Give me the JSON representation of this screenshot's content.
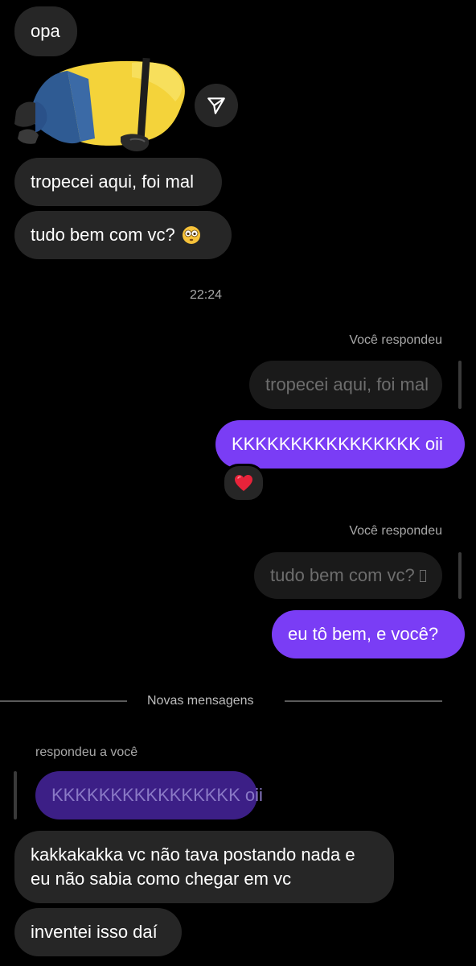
{
  "messages": {
    "m1": "opa",
    "m2": "tropecei aqui, foi mal",
    "m3": "tudo bem com vc?",
    "m4": "KKKKKKKKKKKKKKKK oii",
    "m5": "eu tô bem, e você?",
    "m6_line1": "kakkakakka vc não tava postando nada e",
    "m6_line2": "eu não sabia como chegar em vc",
    "m7": "inventei isso daí"
  },
  "timestamp": "22:24",
  "replies": {
    "r1_label": "Você respondeu",
    "r1_quote": "tropecei aqui, foi mal",
    "r2_label": "Você respondeu",
    "r2_quote": "tudo bem com vc?",
    "r3_label": "respondeu a você",
    "r3_quote": "KKKKKKKKKKKKKKKK oii"
  },
  "divider": {
    "label": "Novas mensagens"
  },
  "icons": {
    "share": "paper-plane-icon",
    "reaction": "red-heart-emoji",
    "face": "flushed-face-emoji",
    "sticker": "minion-sticker"
  },
  "colors": {
    "background": "#000000",
    "incoming_bubble": "#262626",
    "outgoing_bubble": "#7a3df5",
    "heart": "#e8233a"
  }
}
